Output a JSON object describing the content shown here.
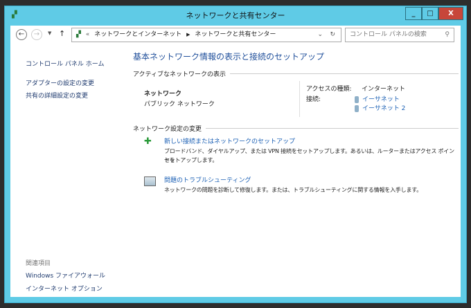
{
  "window": {
    "title": "ネットワークと共有センター",
    "minimize": "_",
    "maximize": "□",
    "close": "X"
  },
  "address": {
    "prefix": "«",
    "crumbs": [
      "ネットワークとインターネット",
      "ネットワークと共有センター"
    ],
    "search_placeholder": "コントロール パネルの検索"
  },
  "sidebar": {
    "home": "コントロール パネル ホーム",
    "items": [
      "アダプターの設定の変更",
      "共有の詳細設定の変更"
    ],
    "related_heading": "関連項目",
    "related": [
      "Windows ファイアウォール",
      "インターネット オプション"
    ]
  },
  "main": {
    "title": "基本ネットワーク情報の表示と接続のセットアップ",
    "active_heading": "アクティブなネットワークの表示",
    "network_name": "ネットワーク",
    "network_type": "パブリック ネットワーク",
    "access_label": "アクセスの種類:",
    "access_value": "インターネット",
    "conn_label": "接続:",
    "connections": [
      "イーサネット",
      "イーサネット 2"
    ],
    "change_heading": "ネットワーク設定の変更",
    "tasks": [
      {
        "title": "新しい接続またはネットワークのセットアップ",
        "desc1": "ブロードバンド、ダイヤルアップ、または VPN 接続をセットアップします。あるいは、ルーターまたはアクセス ポイントを",
        "desc2": "セットアップします。"
      },
      {
        "title": "問題のトラブルシューティング",
        "desc1": "ネットワークの問題を診断して修復します。または、トラブルシューティングに関する情報を入手します。"
      }
    ]
  }
}
